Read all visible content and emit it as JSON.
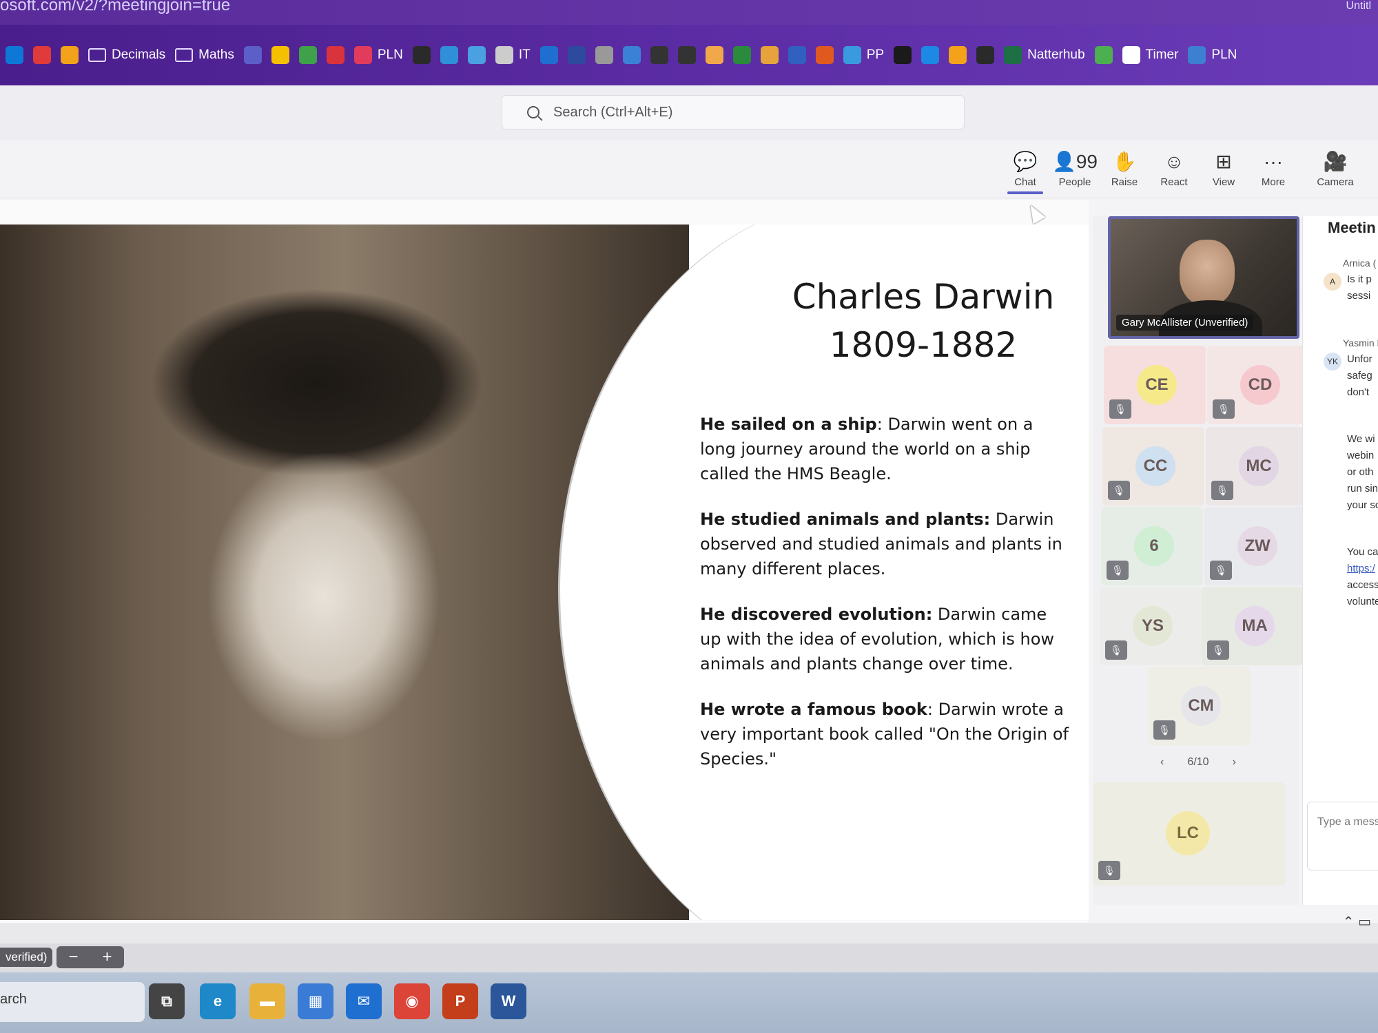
{
  "browser": {
    "url": "osoft.com/v2/?meetingjoin=true",
    "window_right": "Untitl"
  },
  "bookmarks": [
    {
      "label": "",
      "icon": "skype-icon",
      "color": "#0e78d6"
    },
    {
      "label": "",
      "icon": "photo-icon",
      "color": "#e03a3a"
    },
    {
      "label": "",
      "icon": "flower-icon",
      "color": "#f2a21b"
    },
    {
      "label": "Decimals",
      "icon": "folder-icon"
    },
    {
      "label": "Maths",
      "icon": "folder-icon"
    },
    {
      "label": "",
      "icon": "teams-icon",
      "color": "#5b5fc7"
    },
    {
      "label": "",
      "icon": "bee-icon",
      "color": "#f5c000"
    },
    {
      "label": "",
      "icon": "map-icon",
      "color": "#3fa14a"
    },
    {
      "label": "",
      "icon": "tb-icon",
      "color": "#d9343c"
    },
    {
      "label": "PLN",
      "icon": "pln-icon",
      "color": "#e23b5c"
    },
    {
      "label": "",
      "icon": "r-icon",
      "color": "#2a2a2a"
    },
    {
      "label": "",
      "icon": "mail-icon",
      "color": "#2f8fd8"
    },
    {
      "label": "",
      "icon": "person-icon",
      "color": "#4aa0e0"
    },
    {
      "label": "IT",
      "icon": "it-icon",
      "color": "#cccccc"
    },
    {
      "label": "",
      "icon": "globe-icon",
      "color": "#1f6fd0"
    },
    {
      "label": "",
      "icon": "grid-icon",
      "color": "#2e4a9e"
    },
    {
      "label": "",
      "icon": "ball-icon",
      "color": "#999999"
    },
    {
      "label": "",
      "icon": "p-icon",
      "color": "#3b82d6"
    },
    {
      "label": "",
      "icon": "bolt-icon",
      "color": "#333333"
    },
    {
      "label": "",
      "icon": "hand-icon",
      "color": "#333333"
    },
    {
      "label": "",
      "icon": "egg-icon",
      "color": "#f1a84a"
    },
    {
      "label": "",
      "icon": "tp-icon",
      "color": "#2a8b3c"
    },
    {
      "label": "",
      "icon": "house-icon",
      "color": "#e6a33c"
    },
    {
      "label": "",
      "icon": "chat-bubble-icon",
      "color": "#3060c0"
    },
    {
      "label": "",
      "icon": "swirl-icon",
      "color": "#e05a20"
    },
    {
      "label": "PP",
      "icon": "windows-icon",
      "color": "#3a9ae0"
    },
    {
      "label": "",
      "icon": "k-icon",
      "color": "#1a1a1a"
    },
    {
      "label": "",
      "icon": "c-icon",
      "color": "#1e88e5"
    },
    {
      "label": "",
      "icon": "book-icon",
      "color": "#f4a21a"
    },
    {
      "label": "",
      "icon": "r2-icon",
      "color": "#2a2a2a"
    },
    {
      "label": "Natterhub",
      "icon": "excel-icon",
      "color": "#1d7044"
    },
    {
      "label": "",
      "icon": "leaf-icon",
      "color": "#4caf50"
    },
    {
      "label": "Timer",
      "icon": "timer-icon",
      "color": "#ffffff"
    },
    {
      "label": "PLN",
      "icon": "pln2-icon",
      "color": "#3d7fd0"
    }
  ],
  "teams": {
    "search_placeholder": "Search (Ctrl+Alt+E)",
    "controls": [
      {
        "name": "chat",
        "label": "Chat",
        "glyph": "💬",
        "active": true
      },
      {
        "name": "people",
        "label": "People",
        "glyph": "👤99",
        "active": false
      },
      {
        "name": "raise",
        "label": "Raise",
        "glyph": "✋",
        "active": false
      },
      {
        "name": "react",
        "label": "React",
        "glyph": "☺",
        "active": false
      },
      {
        "name": "view",
        "label": "View",
        "glyph": "⊞",
        "active": false
      },
      {
        "name": "more",
        "label": "More",
        "glyph": "···",
        "active": false
      },
      {
        "name": "camera",
        "label": "Camera",
        "glyph": "🎥",
        "active": false
      }
    ]
  },
  "slide": {
    "title_line1": "Charles Darwin",
    "title_line2": "1809-1882",
    "paragraphs": [
      {
        "bold": "He sailed on a ship",
        "text": ": Darwin went on a long journey around the world on a ship called the HMS Beagle."
      },
      {
        "bold": "He studied animals and plants:",
        "text": " Darwin observed and studied animals and plants in many different places."
      },
      {
        "bold": "He discovered evolution:",
        "text": " Darwin came up with the idea of evolution, which is how animals and plants change over time."
      },
      {
        "bold": "He wrote a famous book",
        "text": ": Darwin wrote a very important book called \"On the Origin of Species.\""
      }
    ]
  },
  "participants": {
    "presenter": "Gary McAllister (Unverified)",
    "tiles": [
      {
        "initials": "CE",
        "bg": "#f7dede",
        "av": "#f6e98a"
      },
      {
        "initials": "CD",
        "bg": "#f5e6e6",
        "av": "#f6c9cf"
      },
      {
        "initials": "CC",
        "bg": "#efe7e2",
        "av": "#cfe0f0"
      },
      {
        "initials": "MC",
        "bg": "#ece6e6",
        "av": "#e2d6e4"
      },
      {
        "initials": "6",
        "bg": "#e6ede6",
        "av": "#cfeed4"
      },
      {
        "initials": "ZW",
        "bg": "#e9eaee",
        "av": "#e6d9e6"
      },
      {
        "initials": "YS",
        "bg": "#ececea",
        "av": "#e3e8d6"
      },
      {
        "initials": "MA",
        "bg": "#e6eae2",
        "av": "#e4d8ea"
      },
      {
        "initials": "CM",
        "bg": "#eeeee6",
        "av": "#e6e6ea"
      }
    ],
    "pager": "6/10",
    "featured": {
      "initials": "LC",
      "bg": "#eeede4",
      "av": "#f4e8a8"
    }
  },
  "chat": {
    "title": "Meetin",
    "messages": [
      {
        "sender": "Arnica (",
        "avatar": "A",
        "lines": [
          "Is it p",
          "sessi"
        ]
      },
      {
        "sender": "Yasmin K",
        "avatar": "YK",
        "lines": [
          "Unfor",
          "safeg",
          "don't"
        ]
      },
      {
        "sender": "",
        "avatar": "",
        "lines": [
          "We wi",
          "webin",
          "or oth",
          "run sin",
          "your sc"
        ]
      },
      {
        "sender": "",
        "avatar": "",
        "lines": [
          "You car",
          "https:/",
          "access S",
          "voluntee"
        ]
      }
    ],
    "input_placeholder": "Type a messa"
  },
  "bottom": {
    "zoom_label": "verified)",
    "minus": "−",
    "plus": "+",
    "search_label": "arch"
  },
  "taskbar": [
    {
      "name": "task-view",
      "glyph": "⧉",
      "color": "#444"
    },
    {
      "name": "edge",
      "glyph": "e",
      "color": "#1e88c8"
    },
    {
      "name": "file-explorer",
      "glyph": "▬",
      "color": "#e8b23a"
    },
    {
      "name": "store",
      "glyph": "▦",
      "color": "#3a7bd5"
    },
    {
      "name": "mail",
      "glyph": "✉",
      "color": "#1e6fd0"
    },
    {
      "name": "chrome",
      "glyph": "◉",
      "color": "#db4437"
    },
    {
      "name": "powerpoint",
      "glyph": "P",
      "color": "#c43e1c"
    },
    {
      "name": "word",
      "glyph": "W",
      "color": "#2b579a"
    }
  ]
}
